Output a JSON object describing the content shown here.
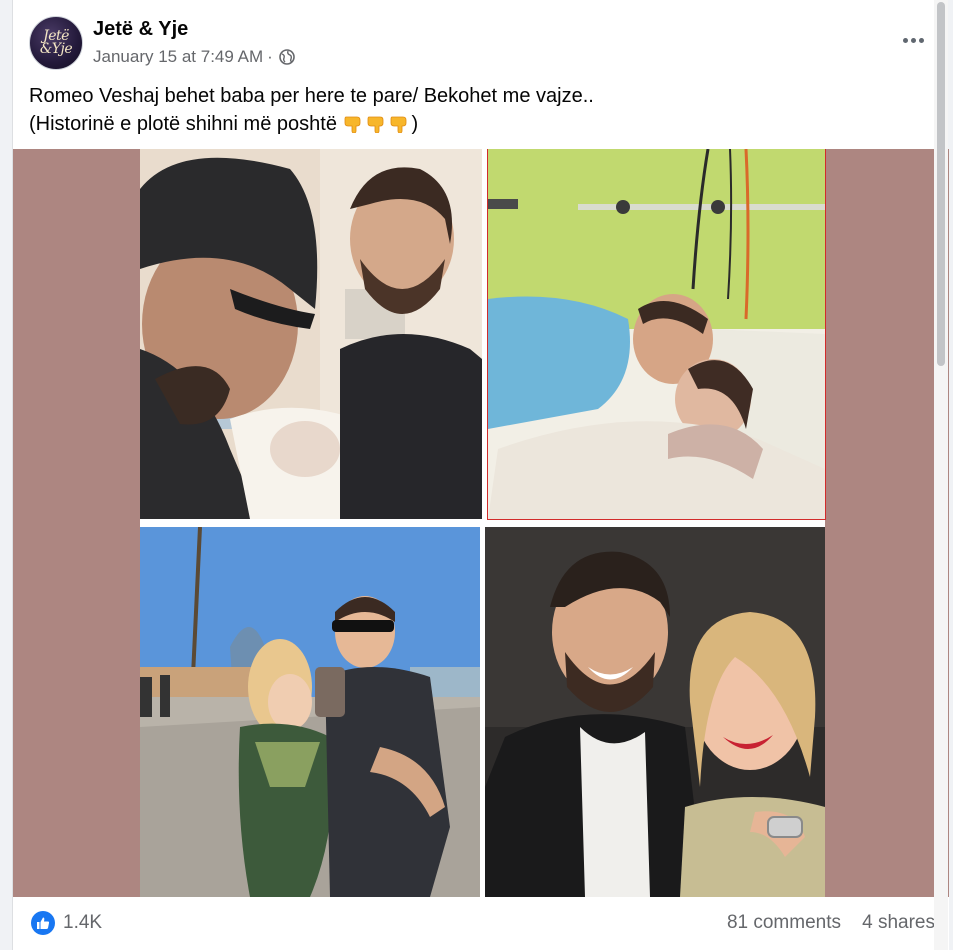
{
  "post": {
    "page_name": "Jetë & Yje",
    "avatar_text": "Jetë\n&Yje",
    "timestamp": "January 15 at 7:49 AM",
    "separator": "·",
    "audience_icon": "globe-icon",
    "more_icon": "more-horizontal-icon",
    "text_line1": "Romeo Veshaj behet baba per here te pare/ Bekohet me vajze..",
    "text_line2_start": "(Historinë e plotë shihni më poshtë",
    "text_line2_end": ")",
    "emoji": "backhand-index-pointing-down",
    "emoji_count": 3
  },
  "media": {
    "background_color": "#ad8681",
    "photos": [
      {
        "name": "photo-man-cap-and-man-with-newborn"
      },
      {
        "name": "photo-hospital-bed-kiss"
      },
      {
        "name": "photo-couple-selfie-beach"
      },
      {
        "name": "photo-couple-smiling-night"
      }
    ]
  },
  "footer": {
    "reaction_icon": "like-icon",
    "reaction_count": "1.4K",
    "comments": "81 comments",
    "shares": "4 shares"
  },
  "colors": {
    "accent": "#1877f2",
    "secondary_text": "#65676b",
    "photo_border_red": "#d22b2b"
  }
}
